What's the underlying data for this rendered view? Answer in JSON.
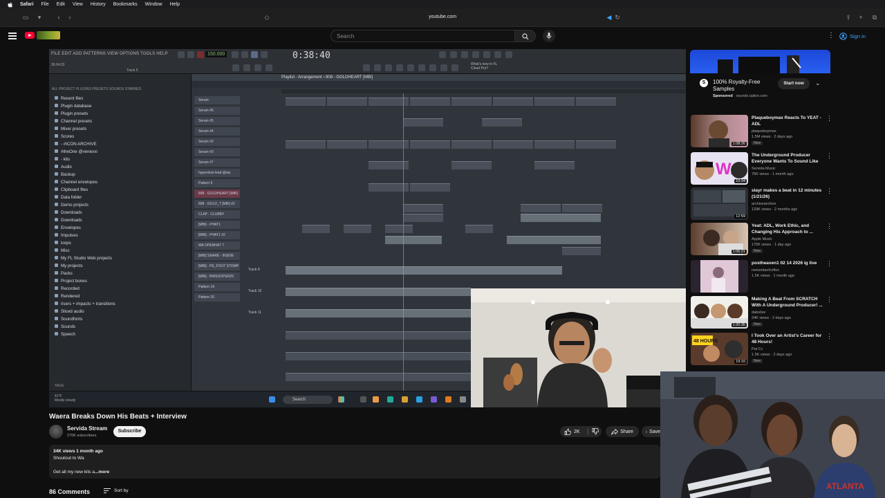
{
  "menubar": {
    "app": "Safari",
    "items": [
      "File",
      "Edit",
      "View",
      "History",
      "Bookmarks",
      "Window",
      "Help"
    ]
  },
  "toolbar": {
    "url": "youtube.com"
  },
  "header": {
    "search_placeholder": "Search",
    "sign_in": "Sign in"
  },
  "player": {
    "fl_menu": "FILE EDIT ADD PATTERNS VIEW OPTIONS TOOLS HELP",
    "fl_time": "0:38:40",
    "fl_tempo": "150.000",
    "fl_project": "36:04:03",
    "fl_pattern_label": "Track 5",
    "fl_news": "What's new in FL Cloud Pro?",
    "playlist_title": "Playlist - Arrangement › 808 - GOLDHEART [MBI]",
    "browser_tabs": "ALL   PROJECT   PLUGINS   PRESETS   SOUNDS   STARRED",
    "browser_items": [
      "Recent files",
      "Plugin database",
      "Plugin presets",
      "Channel presets",
      "Mixer presets",
      "Scores",
      "- #ICON ARCHIVE",
      "#theOne @venexxi",
      "- kits",
      "Audio",
      "Backup",
      "Channel envelopes",
      "Clipboard files",
      "Data folder",
      "Demo projects",
      "Downloads",
      "Downloads",
      "Envelopes",
      "Impulses",
      "loops",
      "Misc",
      "My FL Studio Web projects",
      "My projects",
      "Packs",
      "Project bones",
      "Recorded",
      "Rendered",
      "risers + impacts + transitions",
      "Sliced audio",
      "Soundfonts",
      "Sounds",
      "Speech"
    ],
    "browser_footer": "TAGS",
    "picker": [
      "Serum",
      "Serum #6",
      "Serum #5",
      "Serum #4",
      "Serum #2",
      "Serum #3",
      "Serum #7",
      "hyperslow lead @wa",
      "Pattern 9",
      "808 - GOLDHEART [MBI]",
      "808 - GOLD_T [MBI] #2",
      "CLAP - CLUBBY",
      "[MBI] - PHAT1",
      "[MBI] - PHAT1 #2",
      "WA OPENHAT 7",
      "[MBI] SNARE - INSIDE",
      "[MBI] - PE_FOUT STOMP",
      "[MBI] - BWSOOPER25",
      "Pattern 19",
      "Pattern 20"
    ],
    "tracks": [
      "Track 9",
      "Track 10",
      "Track 11"
    ],
    "taskbar_weather_temp": "41°F",
    "taskbar_weather_desc": "Mostly cloudy",
    "taskbar_search": "Search"
  },
  "video": {
    "title": "Waera Breaks Down His Beats + Interview",
    "channel": "Servida Stream",
    "subscribers": "270K subscribers",
    "subscribe_label": "Subscribe",
    "likes": "2K",
    "share_label": "Share",
    "save_label": "Save",
    "views_date": "34K views  1 month ago",
    "desc_line1": "Shoutout to Wa",
    "desc_line2": "Get all my new kits a",
    "more": "...more",
    "comments": "86 Comments",
    "sort_by": "Sort by"
  },
  "ad": {
    "title": "100% Royalty-Free Samples",
    "sponsored": "Sponsored",
    "domain": "sounds.splice.com",
    "cta": "Start now"
  },
  "recommendations": [
    {
      "title": "Plaqueboymax Reacts To YEAT - ADL",
      "channel": "plaqueboymax",
      "views": "1.5M views · 2 days ago",
      "duration": "1:08:26",
      "badge": "New"
    },
    {
      "title": "The Underground Producer Everyone Wants To Sound Like",
      "channel": "Servida Music",
      "views": "75K views · 1 month ago",
      "duration": "10:34",
      "badge": ""
    },
    {
      "title": "slayr makes a beat in 12 minutes (1/21/26)",
      "channel": "archivearchive",
      "views": "129K views · 2 months ago",
      "duration": "12:59",
      "badge": ""
    },
    {
      "title": "Yeat: ADL, Work Ethic, and Changing His Approach to ...",
      "channel": "Apple Music",
      "views": "175K views · 1 day ago",
      "duration": "1:06:21",
      "badge": "New"
    },
    {
      "title": "postheaven1 02 14 2026 ig live",
      "channel": "rememberforflex",
      "views": "1.5K views · 1 month ago",
      "duration": "",
      "badge": ""
    },
    {
      "title": "Making A Beat From SCRATCH With A Underground Producer! ...",
      "channel": "dabolive",
      "views": "24K views · 2 days ago",
      "duration": "1:20:35",
      "badge": "New"
    },
    {
      "title": "I Took Over an Artist's Career for 48 Hours!",
      "channel": "Pat Cc",
      "views": "1.5K views · 2 days ago",
      "duration": "19:16",
      "badge": "New"
    }
  ],
  "colors": {
    "accent": "#ff0033",
    "link": "#3ea6ff",
    "ad_banner": "#2a5ff0"
  }
}
